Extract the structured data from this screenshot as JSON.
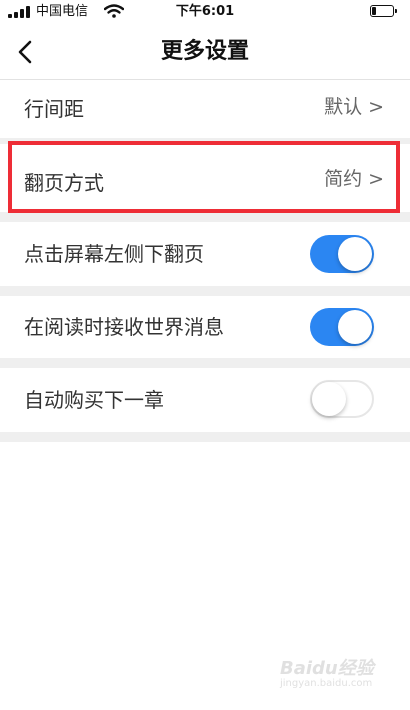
{
  "status_bar": {
    "carrier": "中国电信",
    "time": "下午6:01",
    "battery_level": 0.2
  },
  "nav": {
    "title": "更多设置",
    "back_icon": "chevron-left-icon"
  },
  "settings": {
    "line_spacing": {
      "label": "行间距",
      "value": "默认",
      "chevron": ">"
    },
    "page_turn_mode": {
      "label": "翻页方式",
      "value": "简约",
      "chevron": ">"
    },
    "tap_left_turn": {
      "label": "点击屏幕左侧下翻页",
      "enabled": true
    },
    "receive_world_msgs": {
      "label": "在阅读时接收世界消息",
      "enabled": true
    },
    "auto_buy_next": {
      "label": "自动购买下一章",
      "enabled": false
    }
  },
  "colors": {
    "toggle_on": "#2b86f2",
    "highlight": "#ee2d36"
  },
  "watermark": {
    "logo": "Baidu经验",
    "url": "jingyan.baidu.com"
  }
}
